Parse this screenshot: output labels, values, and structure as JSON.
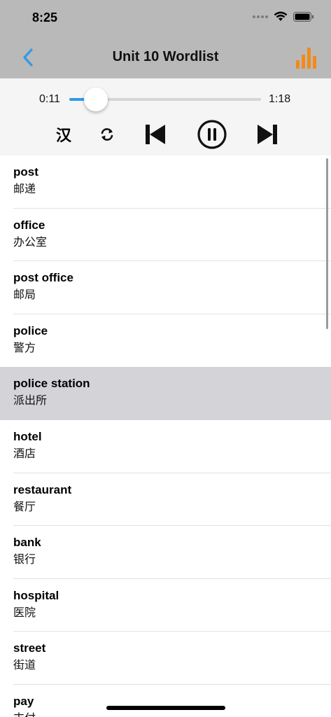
{
  "status": {
    "time": "8:25"
  },
  "nav": {
    "title": "Unit 10 Wordlist"
  },
  "player": {
    "current_time": "0:11",
    "total_time": "1:18",
    "progress": 0.14,
    "han_toggle_label": "汉"
  },
  "colors": {
    "accent": "#2e9be6",
    "chart_icon": "#f08a1c",
    "selected_row": "#d3d3d8"
  },
  "icons": [
    "back-chevron-icon",
    "bar-chart-icon",
    "repeat-icon",
    "skip-previous-icon",
    "pause-icon",
    "skip-next-icon",
    "wifi-icon",
    "battery-icon"
  ],
  "words": [
    {
      "en": "post",
      "zh": "邮递"
    },
    {
      "en": "office",
      "zh": "办公室"
    },
    {
      "en": "post office",
      "zh": "邮局"
    },
    {
      "en": "police",
      "zh": "警方"
    },
    {
      "en": "police station",
      "zh": "派出所"
    },
    {
      "en": "hotel",
      "zh": "酒店"
    },
    {
      "en": "restaurant",
      "zh": "餐厅"
    },
    {
      "en": "bank",
      "zh": "银行"
    },
    {
      "en": "hospital",
      "zh": "医院"
    },
    {
      "en": "street",
      "zh": "街道"
    },
    {
      "en": "pay",
      "zh": "支付"
    }
  ],
  "selected_index": 4
}
